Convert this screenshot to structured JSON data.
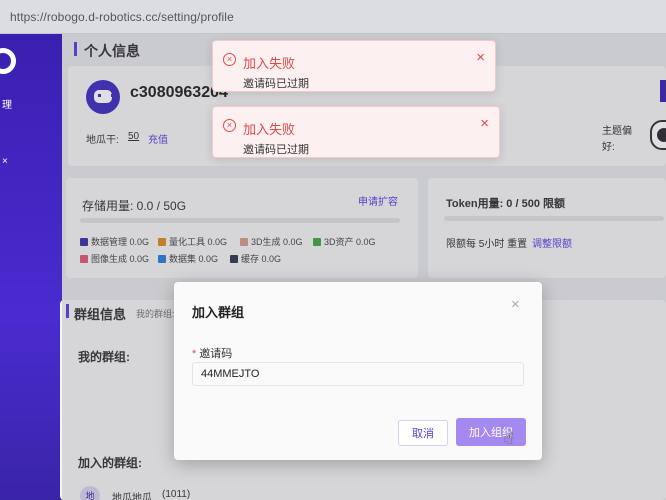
{
  "browser": {
    "url": "https://robogo.d-robotics.cc/setting/profile"
  },
  "sidebar": {
    "nav_glyph_1": "理",
    "nav_glyph_2": "×"
  },
  "profile": {
    "section_title": "个人信息",
    "username": "c3080963204",
    "credits_label": "地瓜干:",
    "credits_value": "50",
    "recharge_link": "充值",
    "theme_label_1": "主题偏",
    "theme_label_2": "好:"
  },
  "storage": {
    "title": "存储用量: 0.0 / 50G",
    "expand_link": "申请扩容",
    "legend": [
      {
        "label": "数据管理 0.0G",
        "color": "#3b32a8"
      },
      {
        "label": "量化工具 0.0G",
        "color": "#e08a1e"
      },
      {
        "label": "3D生成 0.0G",
        "color": "#d99a8a"
      },
      {
        "label": "3D资产 0.0G",
        "color": "#3ea840"
      },
      {
        "label": "图像生成 0.0G",
        "color": "#e05a78"
      },
      {
        "label": "数据集 0.0G",
        "color": "#2a7ed8"
      },
      {
        "label": "缓存 0.0G",
        "color": "#2c3a50"
      }
    ]
  },
  "token": {
    "title": "Token用量: 0 / 500 限额",
    "reset_text": "限额每 5小时 重置",
    "adjust_link": "调整限额"
  },
  "groups": {
    "section_title": "群组信息",
    "subtitle": "我的群组:",
    "my_groups_label": "我的群组:",
    "joined_groups_label": "加入的群组:",
    "joined_items": [
      {
        "avatar": "地",
        "name": "地瓜地瓜",
        "count": "(1011)"
      }
    ]
  },
  "toasts": [
    {
      "title": "加入失败",
      "message": "邀请码已过期"
    },
    {
      "title": "加入失败",
      "message": "邀请码已过期"
    }
  ],
  "modal": {
    "title": "加入群组",
    "field_label": "邀请码",
    "field_value": "44MMEJTO",
    "cancel_label": "取消",
    "join_label": "加入组织"
  },
  "colors": {
    "brand": "#5a3de0",
    "error": "#e24a4a",
    "sidebar": "#3b1fb0"
  }
}
